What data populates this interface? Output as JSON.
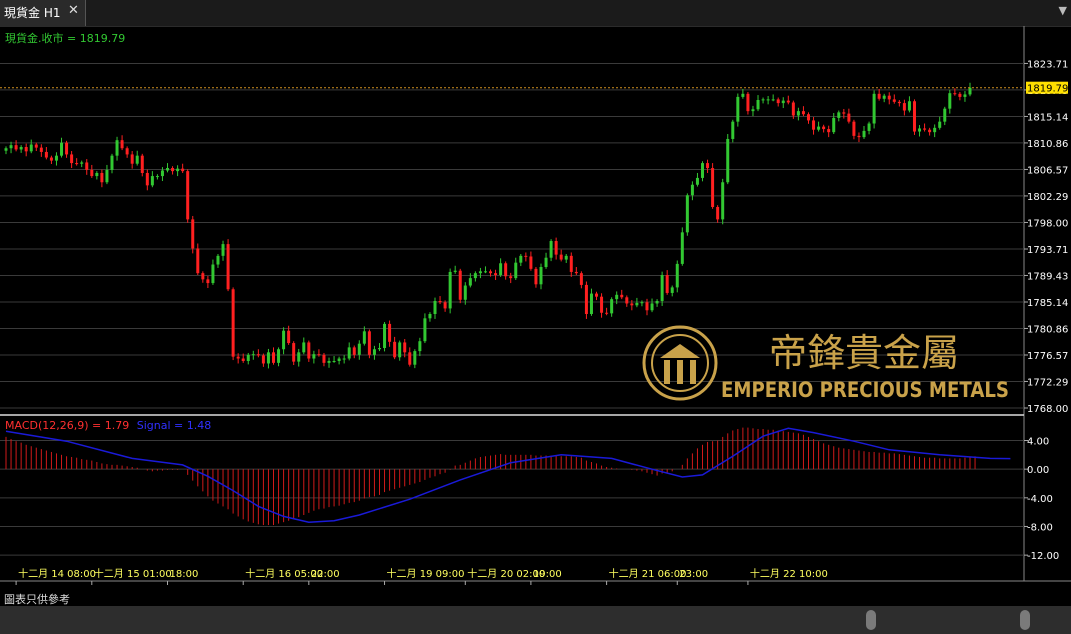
{
  "tab": {
    "title": "現貨金 H1",
    "close_glyph": "✕"
  },
  "menu_arrow_glyph": "▼",
  "price_label": "現貨金.收市 = 1819.79",
  "macd_label": {
    "macd": "MACD(12,26,9) = 1.79",
    "signal": "Signal = 1.48"
  },
  "footer_note": "圖表只供參考",
  "watermark": {
    "text": "EMPERIO PRECIOUS METALS",
    "chinese": "帝鋒貴金屬"
  },
  "colors": {
    "up": "#32c832",
    "down": "#ff2020",
    "grid": "#3a3a3a",
    "signal": "#1a1ad8",
    "macd_bar": "#d01a1a",
    "axis_text": "#ffffff",
    "time_text": "#ffff60",
    "current_price_bg": "#ffe000",
    "current_line": "#d09020"
  },
  "chart_data": [
    {
      "type": "candlestick",
      "title": "現貨金 H1",
      "y_ticks": [
        1823.71,
        1819.43,
        1815.14,
        1810.86,
        1806.57,
        1802.29,
        1798.0,
        1793.71,
        1789.43,
        1785.14,
        1780.86,
        1776.57,
        1772.29,
        1768.0
      ],
      "ylim": [
        1768.0,
        1825.4
      ],
      "current_price": 1819.79,
      "x_labels": [
        "十二月 14 08:00",
        "十二月 15 01:00",
        "18:00",
        "十二月 16 05:00",
        "22:00",
        "十二月 19 09:00",
        "十二月 20 02:00",
        "19:00",
        "十二月 21 06:00",
        "23:00",
        "十二月 22 10:00"
      ],
      "x_label_bar_index": [
        2,
        17,
        32,
        47,
        60,
        75,
        91,
        104,
        119,
        133,
        147
      ],
      "close": [
        1810.0,
        1810.5,
        1809.8,
        1810.2,
        1809.5,
        1810.6,
        1810.1,
        1809.4,
        1808.5,
        1808.0,
        1808.8,
        1810.9,
        1809.0,
        1807.6,
        1807.5,
        1807.7,
        1806.5,
        1805.5,
        1806.0,
        1804.5,
        1806.5,
        1808.8,
        1811.3,
        1810.0,
        1809.0,
        1807.5,
        1808.8,
        1806.0,
        1804.0,
        1805.5,
        1805.5,
        1806.4,
        1806.8,
        1806.3,
        1806.7,
        1806.3,
        1798.5,
        1793.8,
        1789.8,
        1788.8,
        1788.2,
        1791.2,
        1792.6,
        1794.5,
        1787.2,
        1776.3,
        1776.0,
        1775.6,
        1776.6,
        1776.7,
        1776.5,
        1775.2,
        1777.0,
        1775.3,
        1777.5,
        1780.5,
        1778.5,
        1775.5,
        1777.0,
        1778.6,
        1776.0,
        1776.7,
        1776.6,
        1775.3,
        1775.6,
        1775.6,
        1776.0,
        1776.0,
        1777.8,
        1776.6,
        1778.4,
        1780.4,
        1776.6,
        1777.5,
        1777.7,
        1781.6,
        1778.7,
        1776.2,
        1778.6,
        1777.0,
        1775.0,
        1777.2,
        1778.8,
        1782.5,
        1783.2,
        1785.3,
        1785.1,
        1784.1,
        1790.0,
        1790.2,
        1785.5,
        1787.8,
        1789.0,
        1789.8,
        1790.1,
        1790.1,
        1789.8,
        1789.5,
        1791.4,
        1789.3,
        1789.0,
        1791.5,
        1792.6,
        1792.5,
        1790.5,
        1788.0,
        1790.8,
        1792.3,
        1795.0,
        1792.8,
        1792.0,
        1792.6,
        1790.0,
        1789.8,
        1787.9,
        1783.2,
        1786.5,
        1786.0,
        1783.4,
        1783.3,
        1785.6,
        1786.3,
        1785.9,
        1784.9,
        1784.6,
        1785.0,
        1785.1,
        1783.8,
        1784.9,
        1785.3,
        1789.5,
        1786.6,
        1787.5,
        1791.3,
        1796.4,
        1802.4,
        1804.1,
        1805.2,
        1807.6,
        1806.8,
        1800.5,
        1798.5,
        1804.5,
        1811.5,
        1814.3,
        1818.3,
        1818.8,
        1816.0,
        1816.3,
        1817.8,
        1817.9,
        1817.9,
        1817.9,
        1817.3,
        1817.7,
        1817.4,
        1815.3,
        1816.0,
        1815.5,
        1814.5,
        1813.0,
        1813.5,
        1813.1,
        1812.6,
        1814.9,
        1815.8,
        1815.6,
        1814.3,
        1812.0,
        1811.8,
        1812.8,
        1814.0,
        1818.8,
        1818.0,
        1818.5,
        1817.9,
        1817.5,
        1817.3,
        1816.1,
        1817.6,
        1812.7,
        1813.2,
        1813.0,
        1812.6,
        1813.3,
        1814.3,
        1816.4,
        1818.9,
        1818.8,
        1818.3,
        1818.7,
        1819.79
      ],
      "macd_ticks": [
        4.0,
        0.0,
        -4.0,
        -8.0,
        -12.0
      ],
      "macd_ylim": [
        -12.4,
        7.0
      ],
      "macd": [
        4.5,
        4.2,
        3.9,
        3.7,
        3.4,
        3.2,
        3.0,
        2.8,
        2.6,
        2.4,
        2.2,
        2.0,
        1.8,
        1.7,
        1.6,
        1.4,
        1.3,
        1.2,
        1.0,
        0.8,
        0.7,
        0.6,
        0.6,
        0.5,
        0.4,
        0.3,
        0.2,
        0.0,
        -0.2,
        -0.3,
        -0.2,
        -0.2,
        -0.1,
        -0.1,
        -0.1,
        0.0,
        -0.8,
        -1.6,
        -2.4,
        -3.1,
        -3.8,
        -4.4,
        -4.8,
        -5.2,
        -5.6,
        -6.2,
        -6.6,
        -7.0,
        -7.3,
        -7.5,
        -7.7,
        -7.8,
        -7.8,
        -7.8,
        -7.6,
        -7.4,
        -7.2,
        -7.0,
        -6.7,
        -6.4,
        -6.1,
        -5.8,
        -5.6,
        -5.5,
        -5.3,
        -5.2,
        -5.1,
        -4.9,
        -4.7,
        -4.6,
        -4.4,
        -4.1,
        -3.9,
        -3.8,
        -3.6,
        -3.2,
        -3.0,
        -2.8,
        -2.6,
        -2.4,
        -2.2,
        -2.0,
        -1.8,
        -1.5,
        -1.2,
        -1.0,
        -0.7,
        -0.5,
        -0.1,
        0.5,
        0.6,
        0.9,
        1.2,
        1.5,
        1.7,
        1.8,
        1.9,
        2.0,
        2.1,
        2.0,
        2.0,
        2.0,
        2.0,
        2.0,
        2.0,
        1.9,
        1.9,
        1.9,
        1.9,
        1.9,
        1.8,
        1.8,
        1.8,
        1.7,
        1.6,
        1.2,
        1.0,
        0.8,
        0.5,
        0.3,
        0.2,
        0.1,
        0.0,
        0.0,
        -0.1,
        -0.2,
        -0.3,
        -0.5,
        -0.7,
        -0.9,
        -0.6,
        -0.5,
        -0.3,
        0.0,
        0.6,
        1.5,
        2.2,
        2.9,
        3.4,
        3.8,
        3.9,
        4.0,
        4.5,
        5.0,
        5.4,
        5.6,
        5.8,
        5.8,
        5.7,
        5.6,
        5.6,
        5.5,
        5.5,
        5.4,
        5.3,
        5.2,
        5.1,
        5.0,
        4.8,
        4.5,
        4.2,
        3.9,
        3.6,
        3.4,
        3.2,
        3.0,
        2.9,
        2.8,
        2.7,
        2.6,
        2.5,
        2.4,
        2.4,
        2.3,
        2.3,
        2.2,
        2.2,
        2.1,
        2.0,
        1.9,
        1.8,
        1.7,
        1.6,
        1.6,
        1.6,
        1.5,
        1.5,
        1.5,
        1.5,
        1.5,
        1.6,
        1.7,
        1.79
      ],
      "signal": [
        {
          "i": 0,
          "v": 5.3
        },
        {
          "i": 12,
          "v": 3.9
        },
        {
          "i": 25,
          "v": 1.5
        },
        {
          "i": 35,
          "v": 0.6
        },
        {
          "i": 40,
          "v": -1.0
        },
        {
          "i": 45,
          "v": -3.0
        },
        {
          "i": 50,
          "v": -5.2
        },
        {
          "i": 55,
          "v": -6.6
        },
        {
          "i": 60,
          "v": -7.4
        },
        {
          "i": 65,
          "v": -7.2
        },
        {
          "i": 70,
          "v": -6.4
        },
        {
          "i": 80,
          "v": -4.2
        },
        {
          "i": 90,
          "v": -1.5
        },
        {
          "i": 100,
          "v": 0.9
        },
        {
          "i": 110,
          "v": 2.0
        },
        {
          "i": 120,
          "v": 1.5
        },
        {
          "i": 128,
          "v": 0.0
        },
        {
          "i": 134,
          "v": -1.1
        },
        {
          "i": 138,
          "v": -0.8
        },
        {
          "i": 144,
          "v": 1.8
        },
        {
          "i": 150,
          "v": 4.6
        },
        {
          "i": 155,
          "v": 5.7
        },
        {
          "i": 160,
          "v": 5.1
        },
        {
          "i": 168,
          "v": 3.9
        },
        {
          "i": 175,
          "v": 2.7
        },
        {
          "i": 185,
          "v": 2.0
        },
        {
          "i": 195,
          "v": 1.5
        },
        {
          "i": 199,
          "v": 1.48
        }
      ]
    }
  ]
}
